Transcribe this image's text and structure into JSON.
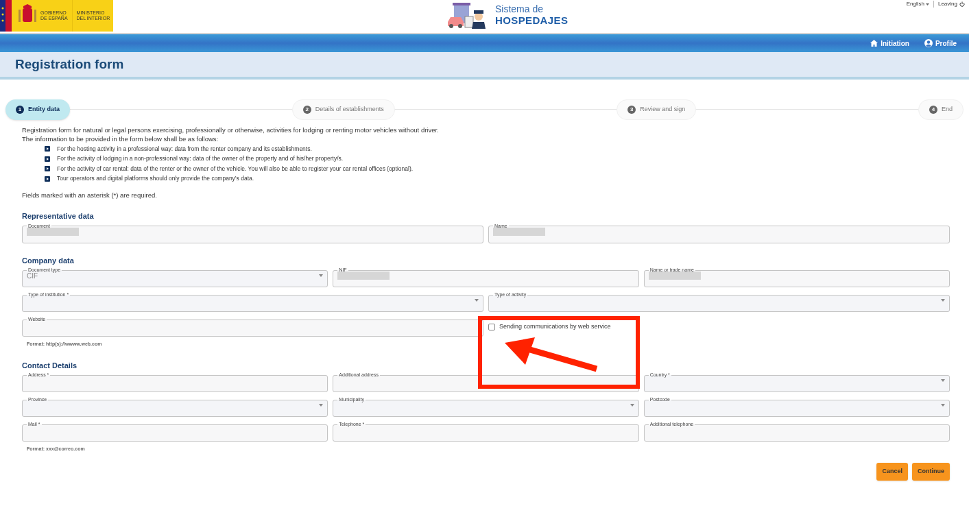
{
  "header": {
    "logo_lines": [
      "GOBIERNO",
      "DE ESPAÑA"
    ],
    "ministry_lines": [
      "MINISTERIO",
      "DEL INTERIOR"
    ],
    "app_name_top": "Sistema de",
    "app_name_bottom": "HOSPEDAJES",
    "language": "English",
    "logout": "Leaving"
  },
  "nav": [
    {
      "label": "Initiation"
    },
    {
      "label": "Profile"
    }
  ],
  "page_title": "Registration form",
  "steps": [
    {
      "number": "1",
      "label": "Entity data",
      "selected": true
    },
    {
      "number": "2",
      "label": "Details of establishments",
      "selected": false
    },
    {
      "number": "3",
      "label": "Review and sign",
      "selected": false
    },
    {
      "number": "4",
      "label": "End",
      "selected": false
    }
  ],
  "intro": "Registration form for natural or legal persons exercising, professionally or otherwise, activities for lodging or renting motor vehicles without driver.",
  "intro2": "The information to be provided in the form below shall be as follows:",
  "bullets": [
    "For the hosting activity in a professional way: data from the renter company and its establishments.",
    "For the activity of lodging in a non-professional way: data of the owner of the property and of his/her property/s.",
    "For the activity of car rental: data of the renter or the owner of the vehicle. You will also be able to register your car rental offices (optional).",
    "Tour operators and digital platforms should only provide the company’s data."
  ],
  "required_note": "Fields marked with an asterisk (*) are required.",
  "sections": [
    {
      "title": "Representative data",
      "rows": [
        {
          "fields": [
            {
              "label": "Document",
              "kind": "text",
              "redacted": true
            },
            {
              "label": "Name",
              "kind": "text",
              "redacted": true
            }
          ]
        }
      ]
    },
    {
      "title": "Company data",
      "rows": [
        {
          "fields": [
            {
              "label": "Document type",
              "kind": "select",
              "value": "CIF",
              "redacted": false
            },
            {
              "label": "NIF",
              "kind": "text",
              "redacted": true
            },
            {
              "label": "Name or trade name",
              "kind": "text",
              "redacted": true
            }
          ]
        },
        {
          "fields": [
            {
              "label": "Type of institution *",
              "kind": "select",
              "redacted": false
            },
            {
              "label": "Type of activity",
              "kind": "select",
              "redacted": false
            }
          ]
        },
        {
          "fields": [
            {
              "label": "Website",
              "kind": "text",
              "redacted": false,
              "hint": "Format: http(s)://wwww.web.com"
            },
            {
              "label": "Sending communications by web service",
              "kind": "checkbox",
              "checked": false
            }
          ]
        }
      ]
    },
    {
      "title": "Contact Details",
      "rows": [
        {
          "fields": [
            {
              "label": "Address *",
              "kind": "text",
              "redacted": false
            },
            {
              "label": "Additional address",
              "kind": "text",
              "redacted": false
            },
            {
              "label": "Country *",
              "kind": "select",
              "redacted": false
            }
          ]
        },
        {
          "fields": [
            {
              "label": "Province",
              "kind": "select",
              "redacted": false
            },
            {
              "label": "Municipality",
              "kind": "select",
              "redacted": false
            },
            {
              "label": "Postcode",
              "kind": "select",
              "redacted": false
            }
          ]
        },
        {
          "fields": [
            {
              "label": "Mail *",
              "kind": "text",
              "redacted": false,
              "hint": "Format: xxx@correo.com"
            },
            {
              "label": "Telephone *",
              "kind": "text",
              "redacted": false
            },
            {
              "label": "Additional telephone",
              "kind": "text",
              "redacted": false
            }
          ]
        }
      ]
    }
  ],
  "buttons": [
    "Cancel",
    "Continue"
  ]
}
